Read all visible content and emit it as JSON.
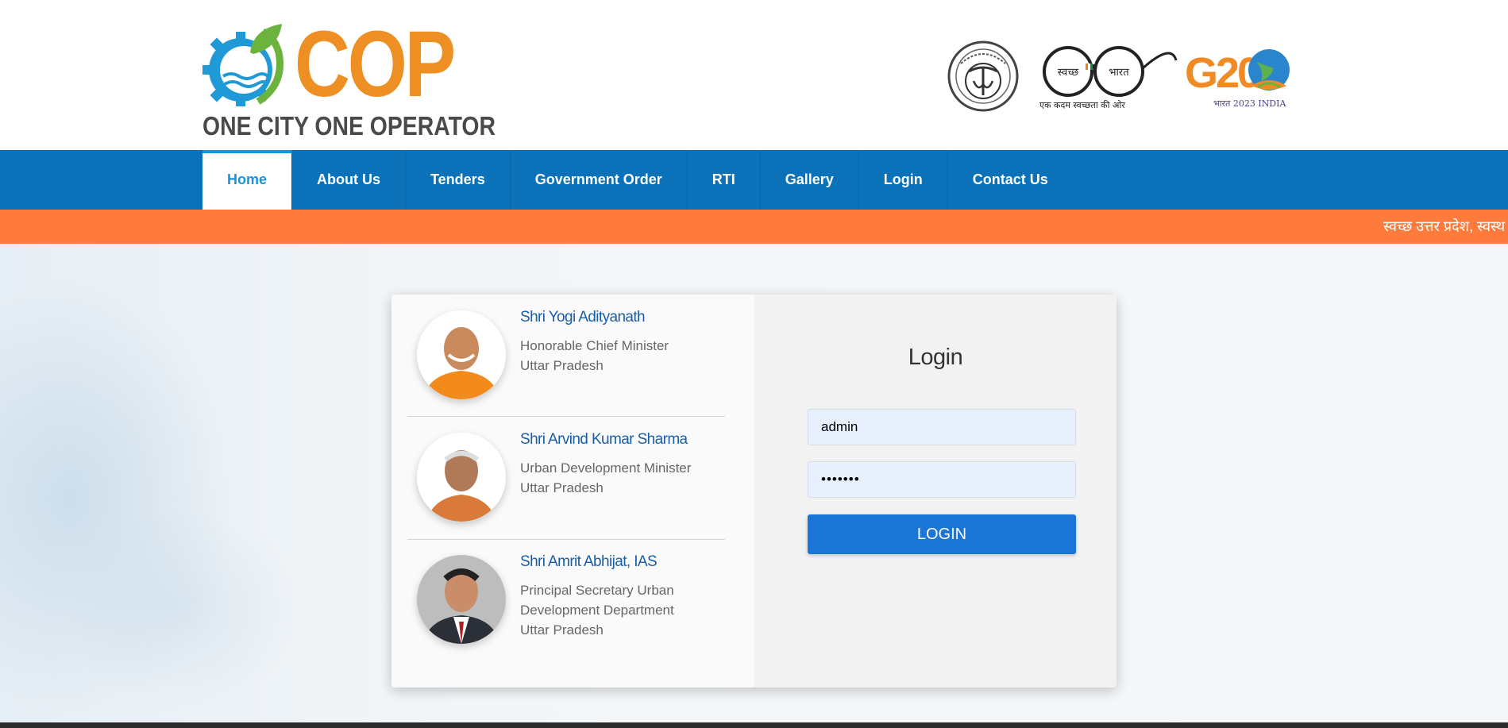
{
  "brand": {
    "logo_text": "COP",
    "tagline": "ONE CITY ONE OPERATOR"
  },
  "partner_logos": [
    {
      "name": "up-government-emblem"
    },
    {
      "name": "swachh-bharat-logo",
      "line1": "स्वच्छ",
      "line2": "भारत",
      "caption": "एक कदम स्वच्छता की ओर"
    },
    {
      "name": "g20-logo",
      "text": "G20",
      "caption": "भारत 2023 INDIA"
    }
  ],
  "nav": {
    "items": [
      "Home",
      "About Us",
      "Tenders",
      "Government Order",
      "RTI",
      "Gallery",
      "Login",
      "Contact Us"
    ],
    "active": "Home"
  },
  "ticker": {
    "text": "स्वच्छ उत्तर प्रदेश, स्वस्थ"
  },
  "leaders": [
    {
      "name": "Shri Yogi Adityanath",
      "role_lines": [
        "Honorable Chief Minister",
        "Uttar Pradesh"
      ]
    },
    {
      "name": "Shri Arvind Kumar Sharma",
      "role_lines": [
        "Urban Development Minister",
        "Uttar Pradesh"
      ]
    },
    {
      "name": "Shri Amrit Abhijat, IAS",
      "role_lines": [
        "Principal Secretary Urban",
        "Development Department",
        "Uttar Pradesh"
      ]
    }
  ],
  "login": {
    "title": "Login",
    "username_value": "admin",
    "password_value": "•••••••",
    "button_label": "LOGIN"
  },
  "colors": {
    "nav_blue": "#0b72ba",
    "ticker_orange": "#ff7b3c",
    "brand_orange": "#ee8f24",
    "button_blue": "#1a75d6",
    "leader_name_blue": "#1a5ea8"
  }
}
